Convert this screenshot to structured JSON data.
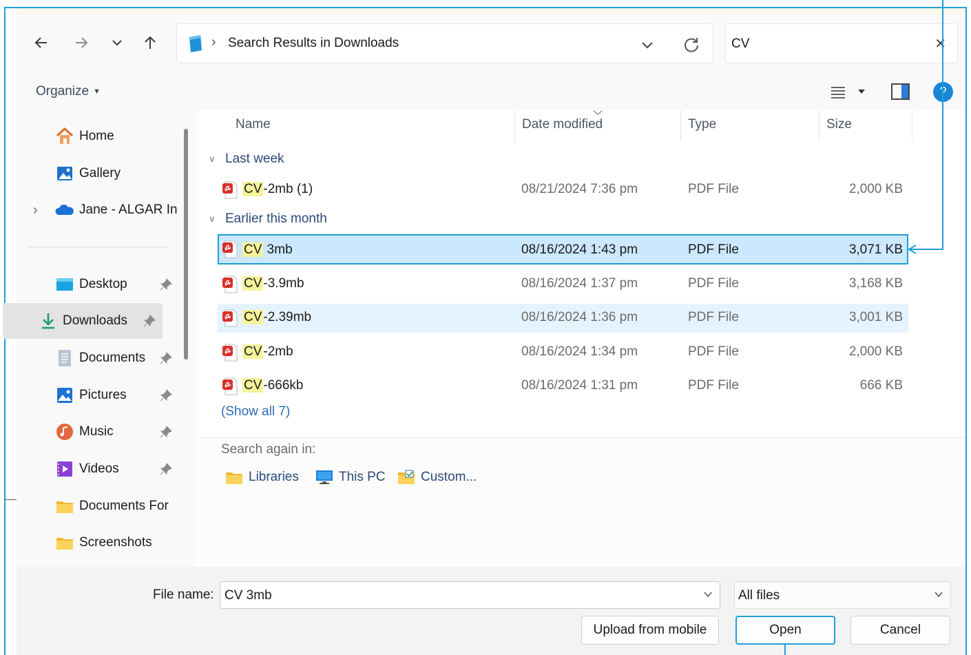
{
  "nav": {
    "back_icon": "arrow-left-icon",
    "forward_icon": "arrow-right-icon",
    "recent_icon": "chevron-down-icon",
    "up_icon": "arrow-up-icon"
  },
  "address": {
    "separator": "›",
    "path": "Search Results in Downloads"
  },
  "search": {
    "value": "CV",
    "clear": "✕"
  },
  "toolbar": {
    "organize_label": "Organize",
    "help": "?"
  },
  "sidebar": {
    "items": [
      {
        "label": "Home",
        "icon": "home-icon"
      },
      {
        "label": "Gallery",
        "icon": "gallery-icon"
      },
      {
        "label": "Jane - ALGAR In",
        "icon": "onedrive-cloud-icon",
        "expand": "›"
      },
      {
        "label": "Desktop",
        "icon": "desktop-icon",
        "pin": "📌"
      },
      {
        "label": "Downloads",
        "icon": "downloads-icon",
        "pin": "📌"
      },
      {
        "label": "Documents",
        "icon": "documents-icon",
        "pin": "📌"
      },
      {
        "label": "Pictures",
        "icon": "pictures-icon",
        "pin": "📌"
      },
      {
        "label": "Music",
        "icon": "music-icon",
        "pin": "📌"
      },
      {
        "label": "Videos",
        "icon": "videos-icon",
        "pin": "📌"
      },
      {
        "label": "Documents For",
        "icon": "folder-icon"
      },
      {
        "label": "Screenshots",
        "icon": "folder-icon"
      }
    ]
  },
  "columns": {
    "name": "Name",
    "date": "Date modified",
    "type": "Type",
    "size": "Size"
  },
  "groups": [
    {
      "label": "Last week"
    },
    {
      "label": "Earlier this month"
    }
  ],
  "files": [
    {
      "match": "CV",
      "rest": "-2mb (1)",
      "date": "08/21/2024 7:36 pm",
      "type": "PDF File",
      "size": "2,000 KB"
    },
    {
      "match": "CV",
      "rest": " 3mb",
      "date": "08/16/2024 1:43 pm",
      "type": "PDF File",
      "size": "3,071 KB",
      "selected": true
    },
    {
      "match": "CV",
      "rest": "-3.9mb",
      "date": "08/16/2024 1:37 pm",
      "type": "PDF File",
      "size": "3,168 KB"
    },
    {
      "match": "CV",
      "rest": "-2.39mb",
      "date": "08/16/2024 1:36 pm",
      "type": "PDF File",
      "size": "3,001 KB"
    },
    {
      "match": "CV",
      "rest": "-2mb",
      "date": "08/16/2024 1:34 pm",
      "type": "PDF File",
      "size": "2,000 KB"
    },
    {
      "match": "CV",
      "rest": "-666kb",
      "date": "08/16/2024 1:31 pm",
      "type": "PDF File",
      "size": "666 KB"
    }
  ],
  "show_all": "(Show all 7)",
  "search_again": {
    "label": "Search again in:",
    "links": [
      {
        "label": "Libraries",
        "icon": "libraries-folder-icon"
      },
      {
        "label": "This PC",
        "icon": "this-pc-icon"
      },
      {
        "label": "Custom...",
        "icon": "custom-folder-icon"
      }
    ]
  },
  "footer": {
    "file_name_label": "File name:",
    "file_name_value": "CV 3mb",
    "filter_value": "All files",
    "upload_label": "Upload from mobile",
    "open_label": "Open",
    "cancel_label": "Cancel"
  },
  "colors": {
    "accent": "#1f9fd5",
    "selection": "#cce8ff",
    "hover": "#e5f3ff",
    "highlight": "#f7f39a",
    "pdf_red": "#d9302b"
  }
}
